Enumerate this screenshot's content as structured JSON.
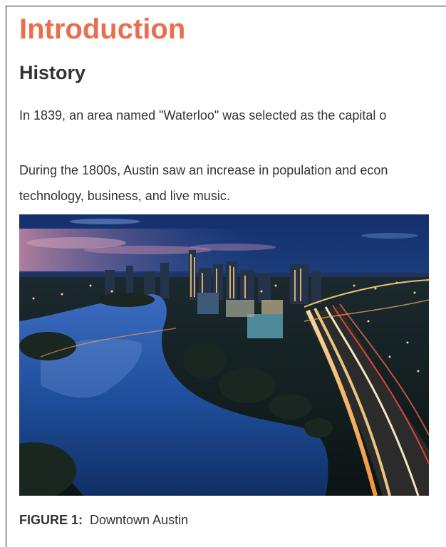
{
  "article": {
    "title": "Introduction",
    "section_heading": "History",
    "paragraph_1": "In 1839, an area named \"Waterloo\" was selected as the capital o",
    "paragraph_2_line_1": "During the 1800s, Austin saw an increase in population and econ",
    "paragraph_2_line_2": "technology, business, and live music."
  },
  "figure": {
    "label": "FIGURE 1:",
    "caption": "Downtown Austin"
  },
  "colors": {
    "title": "#e86f4d",
    "text": "#333333"
  }
}
